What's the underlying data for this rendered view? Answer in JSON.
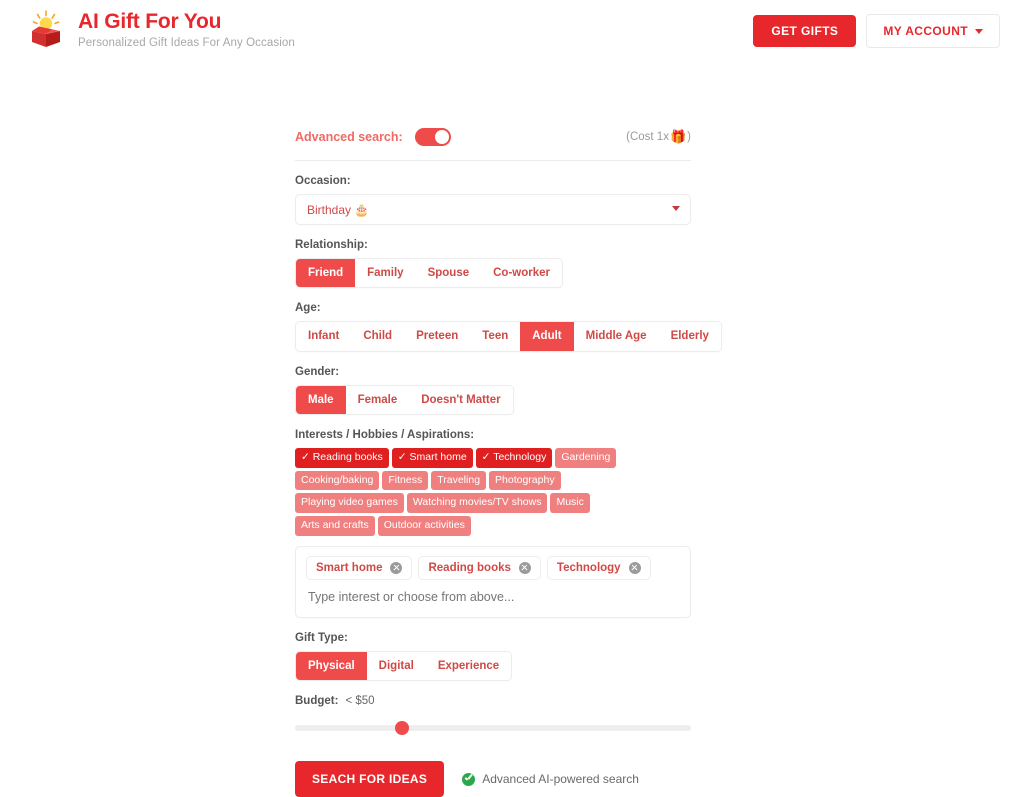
{
  "header": {
    "brand_title": "AI Gift For You",
    "brand_subtitle": "Personalized Gift Ideas For Any Occasion",
    "logo_icon": "gift-box-lightbulb-icon",
    "get_gifts_label": "GET GIFTS",
    "my_account_label": "MY ACCOUNT",
    "caret_icon": "chevron-down-icon"
  },
  "form": {
    "advanced_search_label": "Advanced search:",
    "advanced_search_on": true,
    "cost_note_text": "(Cost 1x",
    "cost_note_icon": "🎁",
    "cost_note_close": ")",
    "occasion": {
      "label": "Occasion:",
      "value": "Birthday 🎂",
      "options": [
        "Birthday 🎂"
      ]
    },
    "relationship": {
      "label": "Relationship:",
      "options": [
        "Friend",
        "Family",
        "Spouse",
        "Co-worker"
      ],
      "selected": "Friend"
    },
    "age": {
      "label": "Age:",
      "options": [
        "Infant",
        "Child",
        "Preteen",
        "Teen",
        "Adult",
        "Middle Age",
        "Elderly"
      ],
      "selected": "Adult"
    },
    "gender": {
      "label": "Gender:",
      "options": [
        "Male",
        "Female",
        "Doesn't Matter"
      ],
      "selected": "Male"
    },
    "interests": {
      "label": "Interests / Hobbies / Aspirations:",
      "tags": [
        {
          "label": "✓ Reading books",
          "selected": true
        },
        {
          "label": "✓ Smart home",
          "selected": true
        },
        {
          "label": "✓ Technology",
          "selected": true
        },
        {
          "label": "Gardening",
          "selected": false
        },
        {
          "label": "Cooking/baking",
          "selected": false
        },
        {
          "label": "Fitness",
          "selected": false
        },
        {
          "label": "Traveling",
          "selected": false
        },
        {
          "label": "Photography",
          "selected": false
        },
        {
          "label": "Playing video games",
          "selected": false
        },
        {
          "label": "Watching movies/TV shows",
          "selected": false
        },
        {
          "label": "Music",
          "selected": false
        },
        {
          "label": "Arts and crafts",
          "selected": false
        },
        {
          "label": "Outdoor activities",
          "selected": false
        }
      ],
      "chips": [
        "Smart home",
        "Reading books",
        "Technology"
      ],
      "input_placeholder": "Type interest or choose from above...",
      "input_value": ""
    },
    "gift_type": {
      "label": "Gift Type:",
      "options": [
        "Physical",
        "Digital",
        "Experience"
      ],
      "selected": "Physical"
    },
    "budget": {
      "label": "Budget:",
      "value": "< $50",
      "slider_percent": 27
    },
    "submit_label": "SEACH FOR IDEAS",
    "ai_note": "Advanced AI-powered search",
    "ai_note_icon": "green-check-icon"
  },
  "colors": {
    "brand_red": "#e8272c",
    "accent_red": "#ef4b4b",
    "tag_selected": "#e02020",
    "tag_unselected": "#f08080",
    "green": "#2aa84a"
  }
}
